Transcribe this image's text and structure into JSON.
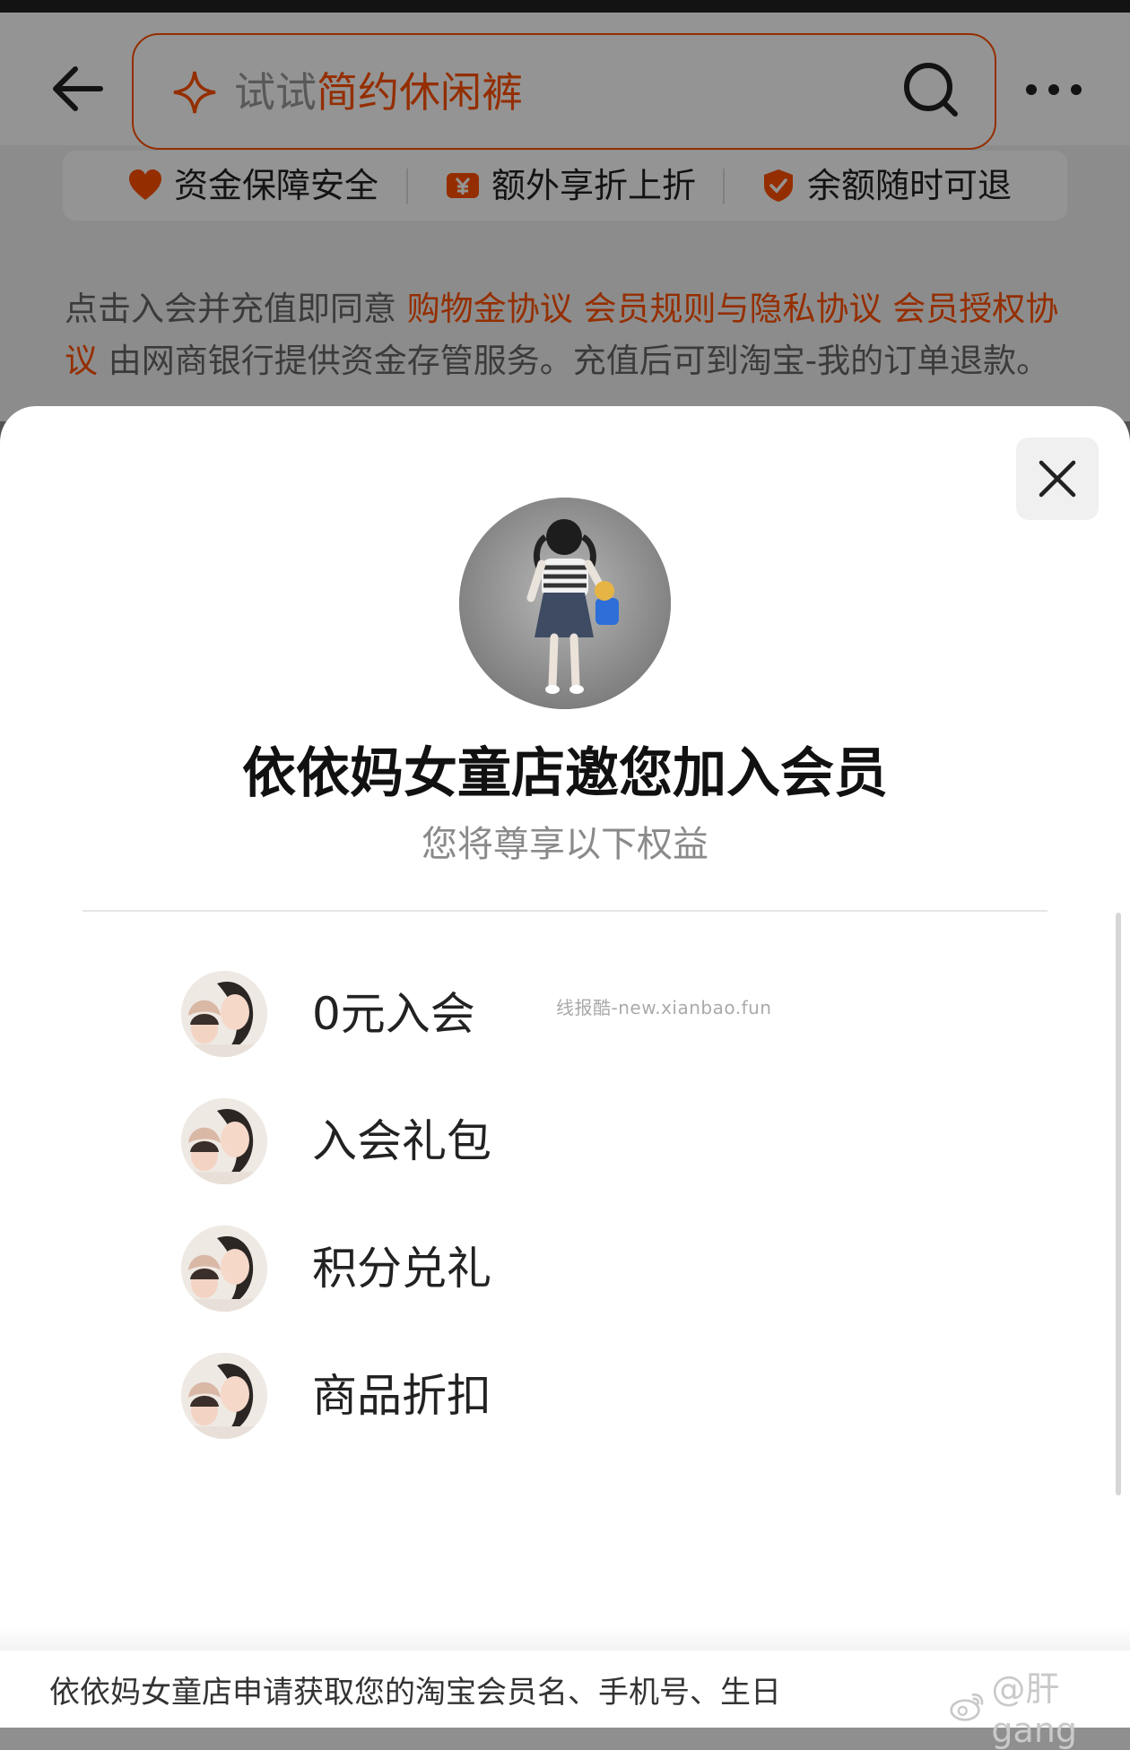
{
  "header": {
    "search_prefix": "试试",
    "search_highlight": "简约休闲裤"
  },
  "guarantees": [
    "资金保障安全",
    "额外享折上折",
    "余额随时可退"
  ],
  "agreement": {
    "prefix": "点击入会并充值即同意 ",
    "link1": "购物金协议",
    "link2": "会员规则与隐私协议",
    "link3": "会员授权协议",
    "suffix": " 由网商银行提供资金存管服务。充值后可到淘宝-我的订单退款。"
  },
  "modal": {
    "title": "依依妈女童店邀您加入会员",
    "subtitle": "您将尊享以下权益",
    "benefits": [
      "0元入会",
      "入会礼包",
      "积分兑礼",
      "商品折扣"
    ],
    "watermark": "线报酷-new.xianbao.fun",
    "consent": "依依妈女童店申请获取您的淘宝会员名、手机号、生日",
    "weibo_handle": "@肝gang"
  },
  "colors": {
    "accent": "#ff5000",
    "text": "#111111",
    "muted": "#8a8a8a"
  },
  "icons": [
    "back-arrow-icon",
    "sparkle-icon",
    "search-icon",
    "more-icon",
    "heart-icon",
    "yen-icon",
    "shield-icon",
    "close-icon",
    "weibo-icon"
  ]
}
